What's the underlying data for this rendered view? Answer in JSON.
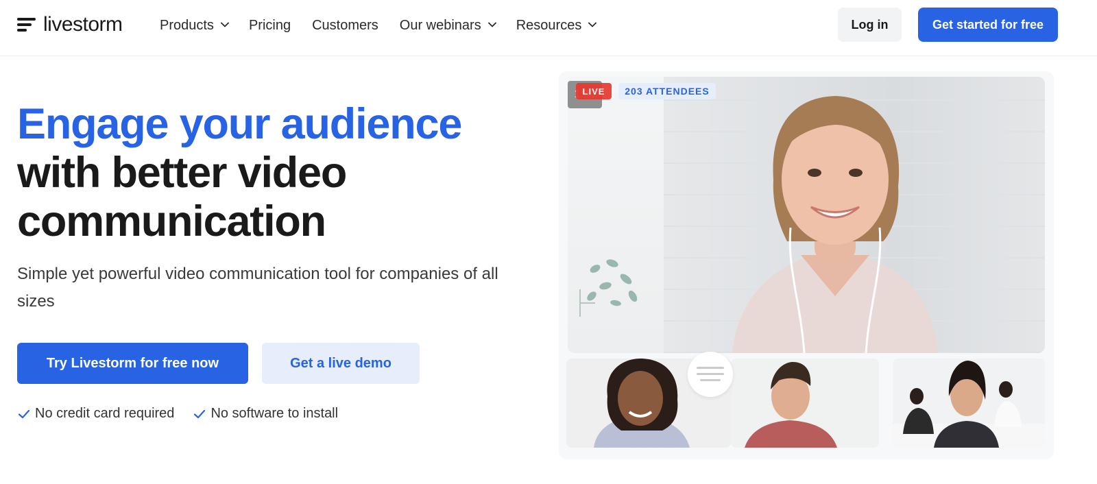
{
  "brand": {
    "name": "livestorm"
  },
  "nav": {
    "items": [
      {
        "label": "Products",
        "dropdown": true
      },
      {
        "label": "Pricing",
        "dropdown": false
      },
      {
        "label": "Customers",
        "dropdown": false
      },
      {
        "label": "Our webinars",
        "dropdown": true
      },
      {
        "label": "Resources",
        "dropdown": true
      }
    ],
    "login_label": "Log in",
    "cta_label": "Get started for free"
  },
  "hero": {
    "title_highlight": "Engage your audience",
    "title_line2": "with better video",
    "title_line3": "communication",
    "subtitle": "Simple yet powerful video communication tool for companies of all sizes",
    "primary_cta": "Try Livestorm for free now",
    "secondary_cta": "Get a live demo",
    "checks": [
      "No credit card required",
      "No software to install"
    ]
  },
  "video": {
    "timer": "1:00",
    "live_label": "LIVE",
    "attendees_label": "203 ATTENDEES"
  },
  "colors": {
    "accent": "#2763e3",
    "accent_light": "#e6eefc",
    "live_red": "#e5392f",
    "text_dark": "#1a1a1a"
  }
}
